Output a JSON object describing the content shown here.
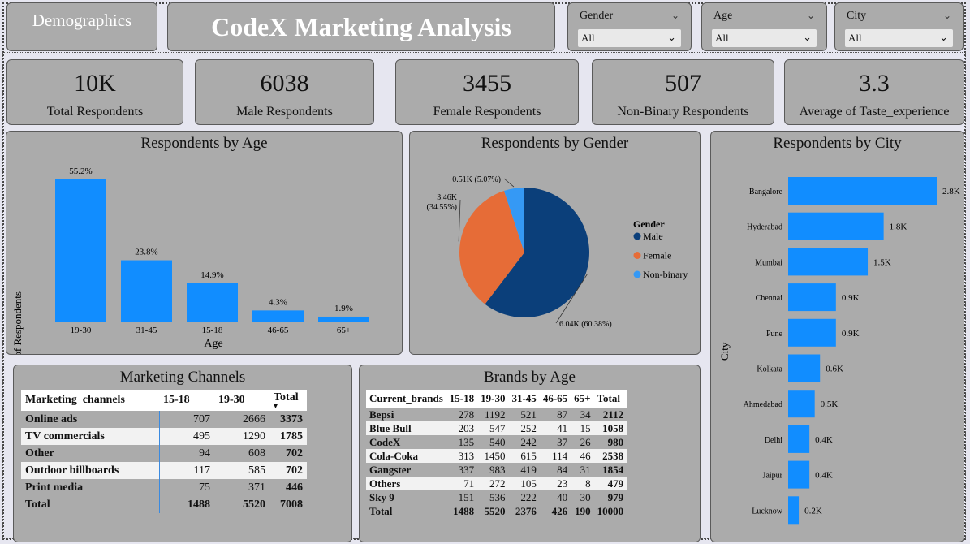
{
  "header": {
    "demographics_button": "Demographics",
    "title": "CodeX Marketing Analysis"
  },
  "filters": {
    "gender": {
      "label": "Gender",
      "value": "All"
    },
    "age": {
      "label": "Age",
      "value": "All"
    },
    "city": {
      "label": "City",
      "value": "All"
    }
  },
  "kpis": {
    "total": {
      "value": "10K",
      "label": "Total Respondents"
    },
    "male": {
      "value": "6038",
      "label": "Male Respondents"
    },
    "female": {
      "value": "3455",
      "label": "Female Respondents"
    },
    "nonbinary": {
      "value": "507",
      "label": "Non-Binary Respondents"
    },
    "taste": {
      "value": "3.3",
      "label": "Average of Taste_experience"
    }
  },
  "colors": {
    "bar": "#118dff",
    "male": "#0b3f7a",
    "female": "#e66c37",
    "nonbinary": "#3599f5",
    "panel": "#ababab"
  },
  "chart_data": [
    {
      "type": "bar",
      "title": "Respondents by Age",
      "xlabel": "Age",
      "ylabel": "No. of Respondents",
      "categories": [
        "19-30",
        "31-45",
        "15-18",
        "46-65",
        "65+"
      ],
      "values": [
        55.2,
        23.8,
        14.9,
        4.3,
        1.9
      ],
      "data_labels": [
        "55.2%",
        "23.8%",
        "14.9%",
        "4.3%",
        "1.9%"
      ]
    },
    {
      "type": "pie",
      "title": "Respondents by Gender",
      "legend_title": "Gender",
      "legend_position": "right",
      "categories": [
        "Male",
        "Female",
        "Non-binary"
      ],
      "values": [
        6038,
        3455,
        507
      ],
      "data_labels": [
        "6.04K (60.38%)",
        "3.46K (34.55%)",
        "0.51K (5.07%)"
      ]
    },
    {
      "type": "bar",
      "orientation": "horizontal",
      "title": "Respondents by City",
      "ylabel": "City",
      "categories": [
        "Bangalore",
        "Hyderabad",
        "Mumbai",
        "Chennai",
        "Pune",
        "Kolkata",
        "Ahmedabad",
        "Delhi",
        "Jaipur",
        "Lucknow"
      ],
      "values": [
        2.8,
        1.8,
        1.5,
        0.9,
        0.9,
        0.6,
        0.5,
        0.4,
        0.4,
        0.2
      ],
      "data_labels": [
        "2.8K",
        "1.8K",
        "1.5K",
        "0.9K",
        "0.9K",
        "0.6K",
        "0.5K",
        "0.4K",
        "0.4K",
        "0.2K"
      ]
    },
    {
      "type": "table",
      "title": "Marketing Channels",
      "columns": [
        "Marketing_channels",
        "15-18",
        "19-30",
        "Total"
      ],
      "rows": [
        [
          "Online ads",
          "707",
          "2666",
          "3373"
        ],
        [
          "TV commercials",
          "495",
          "1290",
          "1785"
        ],
        [
          "Other",
          "94",
          "608",
          "702"
        ],
        [
          "Outdoor billboards",
          "117",
          "585",
          "702"
        ],
        [
          "Print media",
          "75",
          "371",
          "446"
        ],
        [
          "Total",
          "1488",
          "5520",
          "7008"
        ]
      ]
    },
    {
      "type": "table",
      "title": "Brands by Age",
      "columns": [
        "Current_brands",
        "15-18",
        "19-30",
        "31-45",
        "46-65",
        "65+",
        "Total"
      ],
      "rows": [
        [
          "Bepsi",
          "278",
          "1192",
          "521",
          "87",
          "34",
          "2112"
        ],
        [
          "Blue Bull",
          "203",
          "547",
          "252",
          "41",
          "15",
          "1058"
        ],
        [
          "CodeX",
          "135",
          "540",
          "242",
          "37",
          "26",
          "980"
        ],
        [
          "Cola-Coka",
          "313",
          "1450",
          "615",
          "114",
          "46",
          "2538"
        ],
        [
          "Gangster",
          "337",
          "983",
          "419",
          "84",
          "31",
          "1854"
        ],
        [
          "Others",
          "71",
          "272",
          "105",
          "23",
          "8",
          "479"
        ],
        [
          "Sky 9",
          "151",
          "536",
          "222",
          "40",
          "30",
          "979"
        ],
        [
          "Total",
          "1488",
          "5520",
          "2376",
          "426",
          "190",
          "10000"
        ]
      ]
    }
  ]
}
